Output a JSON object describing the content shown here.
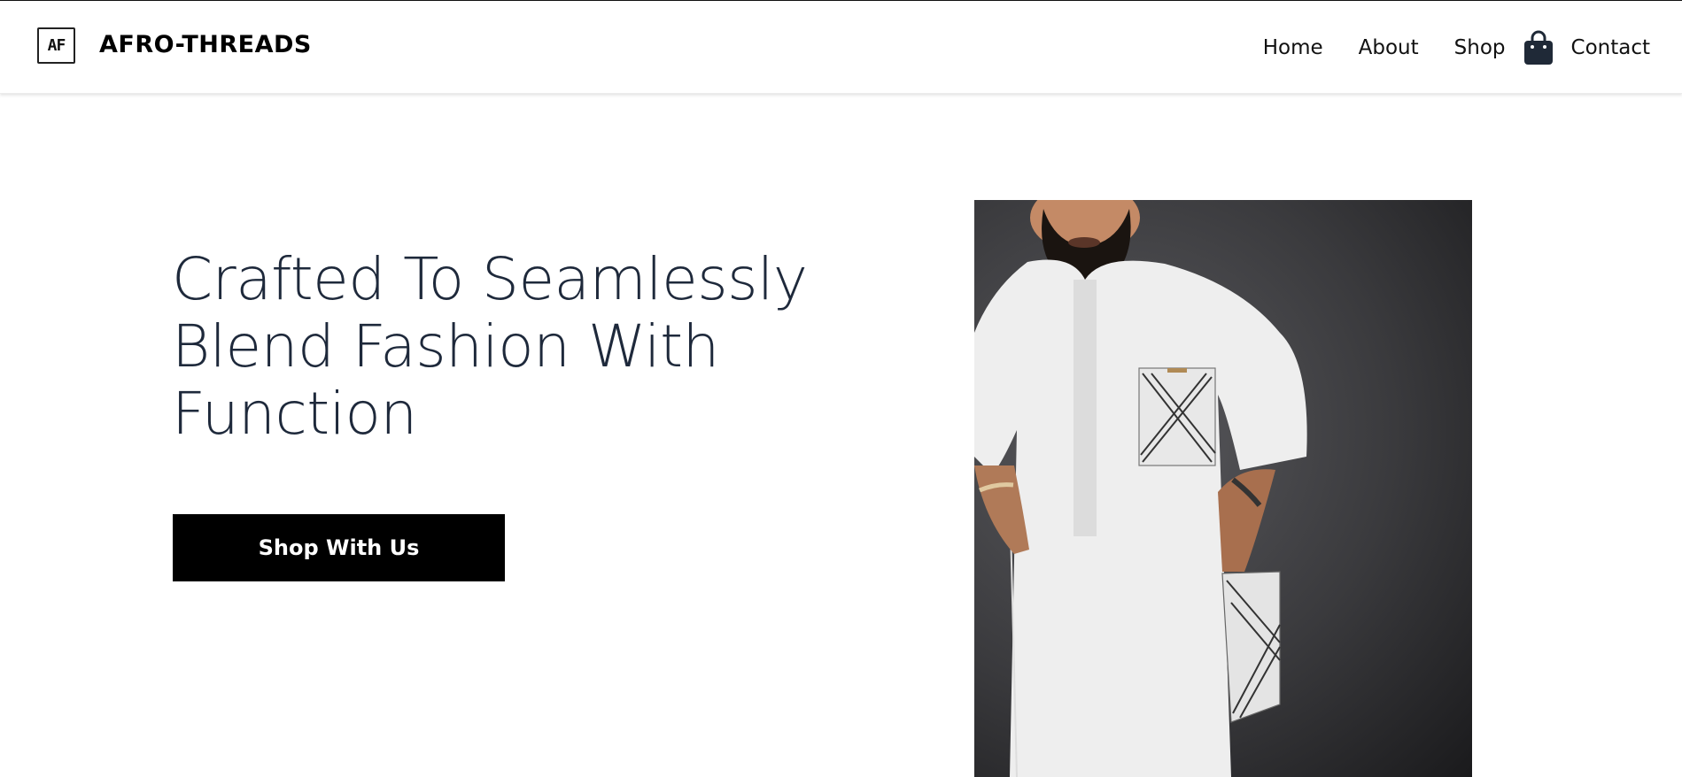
{
  "brand": {
    "logo_initials": "AF",
    "name": "AFRO-THREADS"
  },
  "nav": {
    "items": [
      {
        "label": "Home"
      },
      {
        "label": "About"
      },
      {
        "label": "Shop"
      }
    ],
    "cart_icon": "shopping-bag-icon",
    "contact_label": "Contact"
  },
  "hero": {
    "title": "Crafted To Seamlessly Blend Fashion With Function",
    "cta_label": "Shop With Us",
    "image_subject": "model-in-white-kaftan"
  },
  "colors": {
    "heading": "#1e293b",
    "cta_background": "#000000",
    "cta_text": "#ffffff"
  }
}
